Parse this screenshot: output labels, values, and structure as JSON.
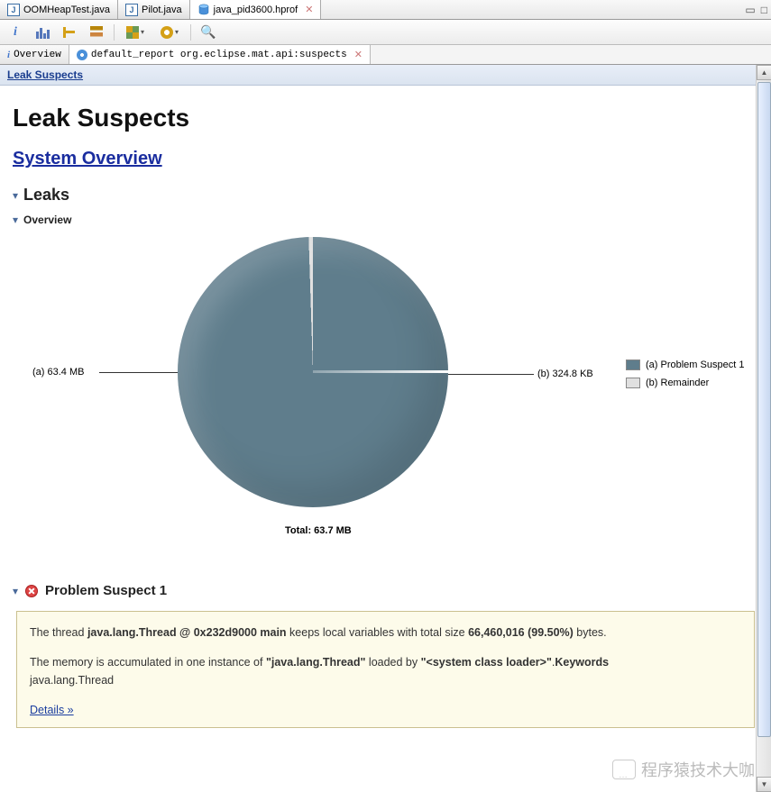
{
  "editorTabs": [
    {
      "label": "OOMHeapTest.java",
      "type": "java"
    },
    {
      "label": "Pilot.java",
      "type": "java"
    },
    {
      "label": "java_pid3600.hprof",
      "type": "hprof",
      "active": true
    }
  ],
  "subTabs": [
    {
      "label": "Overview",
      "icon": "i"
    },
    {
      "label": "default_report  org.eclipse.mat.api:suspects",
      "icon": "cog",
      "active": true
    }
  ],
  "breadcrumb": "Leak Suspects",
  "pageTitle": "Leak Suspects",
  "systemOverview": "System Overview",
  "leaksHeading": "Leaks",
  "overviewHeading": "Overview",
  "chart_data": {
    "type": "pie",
    "title": "",
    "total_label": "Total: 63.7 MB",
    "series": [
      {
        "name": "(a) Problem Suspect 1",
        "label": "(a)  63.4 MB",
        "value_mb": 63.4,
        "percent": 99.5,
        "color": "#5f7d8c"
      },
      {
        "name": "(b) Remainder",
        "label": "(b)  324.8 KB",
        "value_mb": 0.317,
        "percent": 0.5,
        "color": "#e0e0e0"
      }
    ]
  },
  "problem": {
    "title": "Problem Suspect 1",
    "line1_pre": "The thread ",
    "line1_bold1": "java.lang.Thread @ 0x232d9000 main",
    "line1_mid": " keeps local variables with total size ",
    "line1_bold2": "66,460,016 (99.50%)",
    "line1_post": " bytes.",
    "line2_pre": "The memory is accumulated in one instance of ",
    "line2_bold1": "\"java.lang.Thread\"",
    "line2_mid": " loaded by ",
    "line2_bold2": "\"<system class loader>\"",
    "line2_post": ".",
    "keywords_label": "Keywords",
    "keywords_value": "java.lang.Thread",
    "details": "Details »"
  },
  "watermark": "程序猿技术大咖"
}
